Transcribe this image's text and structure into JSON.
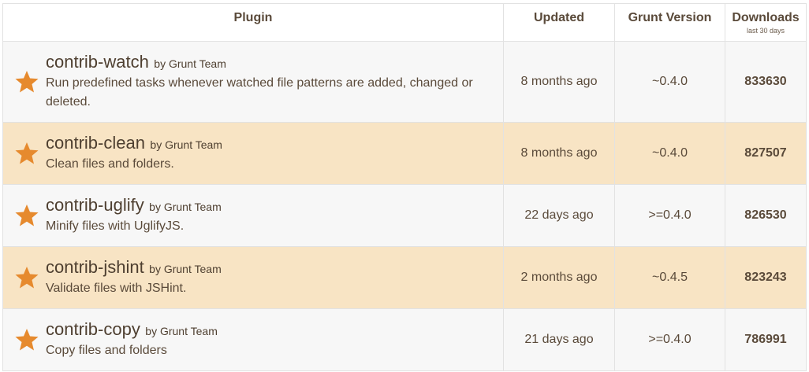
{
  "colors": {
    "accent": "#e68a2e",
    "row_alt": "#f8e4c4",
    "row_base": "#f7f7f7"
  },
  "header": {
    "plugin": "Plugin",
    "updated": "Updated",
    "grunt_version": "Grunt Version",
    "downloads": "Downloads",
    "downloads_sub": "last 30 days"
  },
  "rows": [
    {
      "icon": "star-icon",
      "name": "contrib-watch",
      "author": "by Grunt Team",
      "description": "Run predefined tasks whenever watched file patterns are added, changed or deleted.",
      "updated": "8 months ago",
      "version": "~0.4.0",
      "downloads": "833630"
    },
    {
      "icon": "star-icon",
      "name": "contrib-clean",
      "author": "by Grunt Team",
      "description": "Clean files and folders.",
      "updated": "8 months ago",
      "version": "~0.4.0",
      "downloads": "827507"
    },
    {
      "icon": "star-icon",
      "name": "contrib-uglify",
      "author": "by Grunt Team",
      "description": "Minify files with UglifyJS.",
      "updated": "22 days ago",
      "version": ">=0.4.0",
      "downloads": "826530"
    },
    {
      "icon": "star-icon",
      "name": "contrib-jshint",
      "author": "by Grunt Team",
      "description": "Validate files with JSHint.",
      "updated": "2 months ago",
      "version": "~0.4.5",
      "downloads": "823243"
    },
    {
      "icon": "star-icon",
      "name": "contrib-copy",
      "author": "by Grunt Team",
      "description": "Copy files and folders",
      "updated": "21 days ago",
      "version": ">=0.4.0",
      "downloads": "786991"
    }
  ]
}
